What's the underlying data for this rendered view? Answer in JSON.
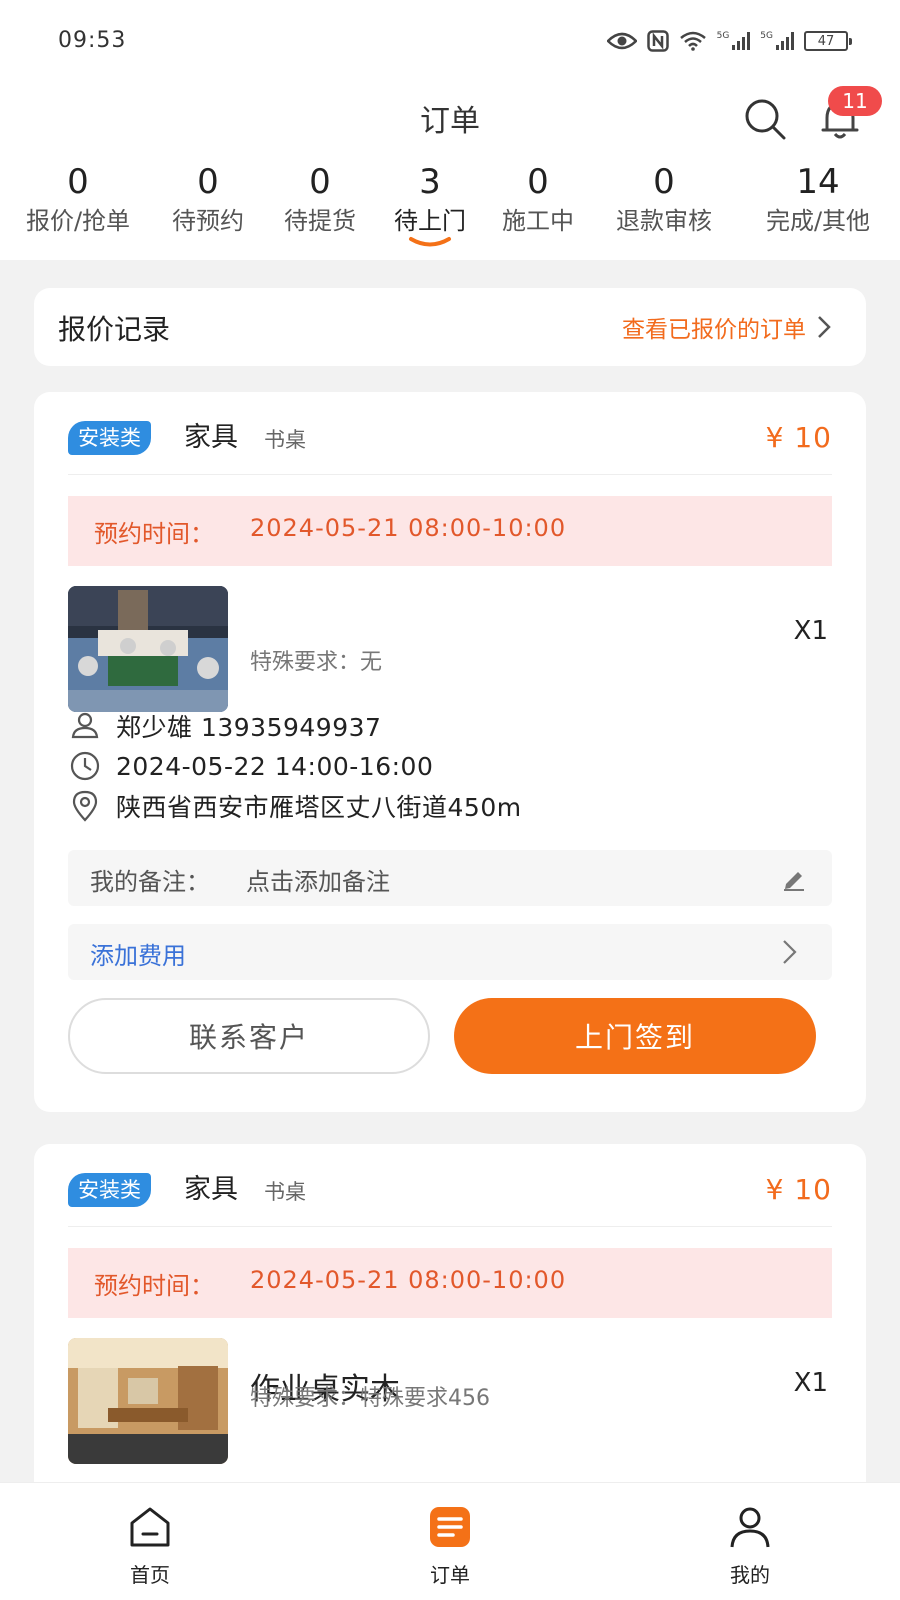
{
  "status_bar": {
    "time": "09:53",
    "signal_tag_1": "5G",
    "signal_tag_2": "5G",
    "battery": "47",
    "icons": [
      "eye-icon",
      "nfc-icon",
      "wifi-icon",
      "signal-icon",
      "signal-icon",
      "battery-icon"
    ]
  },
  "header": {
    "title": "订单",
    "notification_count": "11",
    "icons": [
      "search-icon",
      "bell-icon"
    ]
  },
  "stats": [
    {
      "count": "0",
      "label": "报价/抢单"
    },
    {
      "count": "0",
      "label": "待预约"
    },
    {
      "count": "0",
      "label": "待提货"
    },
    {
      "count": "3",
      "label": "待上门",
      "active": true
    },
    {
      "count": "0",
      "label": "施工中"
    },
    {
      "count": "0",
      "label": "退款审核"
    },
    {
      "count": "14",
      "label": "完成/其他"
    }
  ],
  "quote_record": {
    "title": "报价记录",
    "link": "查看已报价的订单"
  },
  "orders": [
    {
      "tag": "安装类",
      "category": "家具",
      "subcategory": "书桌",
      "price": "¥ 10",
      "appointment_label": "预约时间：",
      "appointment_value": "2024-05-21 08:00-10:00",
      "product_name": "",
      "special_request": "特殊要求：无",
      "quantity": "X1",
      "customer": "郑少雄 13935949937",
      "service_time": "2024-05-22 14:00-16:00",
      "address": "陕西省西安市雁塔区丈八街道450m",
      "remark_label": "我的备注：",
      "remark_value": "点击添加备注",
      "add_fee": "添加费用",
      "contact_button": "联系客户",
      "checkin_button": "上门签到"
    },
    {
      "tag": "安装类",
      "category": "家具",
      "subcategory": "书桌",
      "price": "¥ 10",
      "appointment_label": "预约时间：",
      "appointment_value": "2024-05-21 08:00-10:00",
      "product_name": "作业桌实木",
      "special_request": "特殊要求：特殊要求456",
      "quantity": "X1"
    }
  ],
  "tabbar": [
    {
      "label": "首页",
      "icon": "home-icon"
    },
    {
      "label": "订单",
      "icon": "order-icon",
      "active": true
    },
    {
      "label": "我的",
      "icon": "profile-icon"
    }
  ],
  "colors": {
    "accent": "#f47117",
    "price": "#f26b1d",
    "tag": "#2f8de0",
    "link_blue": "#3a72d8",
    "appointment_bg": "#fde6e6"
  }
}
